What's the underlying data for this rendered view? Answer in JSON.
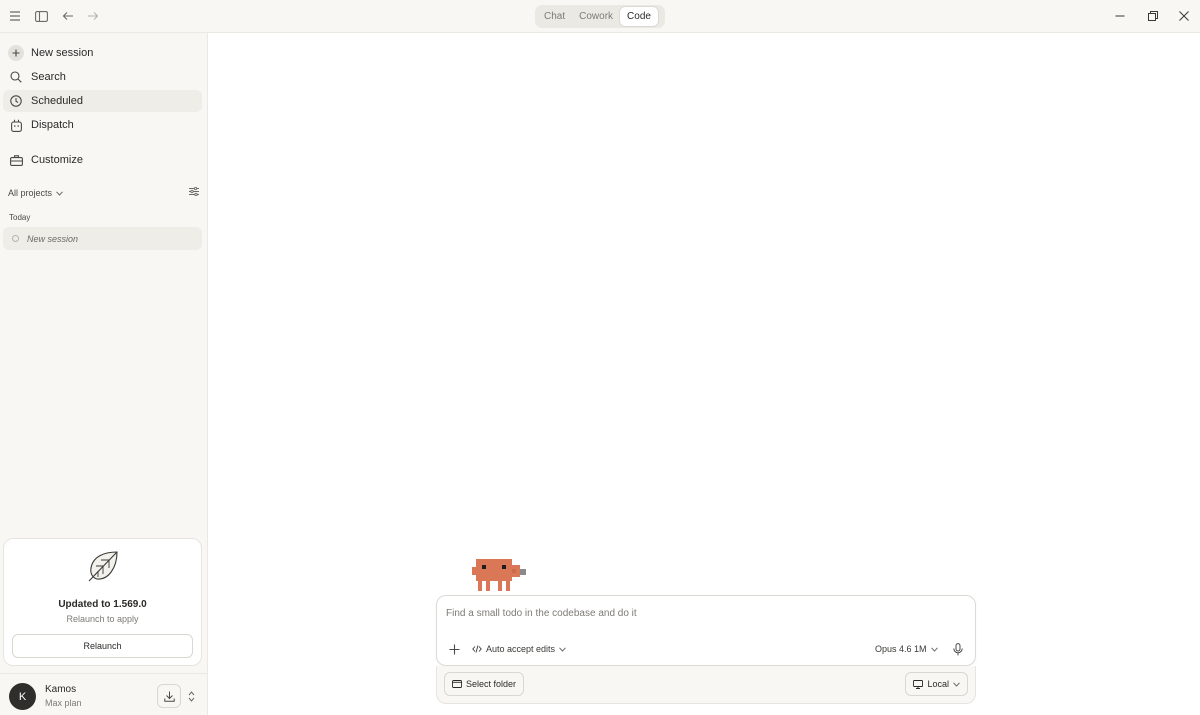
{
  "titlebar": {
    "modes": [
      {
        "label": "Chat",
        "active": false
      },
      {
        "label": "Cowork",
        "active": false
      },
      {
        "label": "Code",
        "active": true
      }
    ]
  },
  "sidebar": {
    "nav": {
      "new_session": "New session",
      "search": "Search",
      "scheduled": "Scheduled",
      "dispatch": "Dispatch",
      "customize": "Customize"
    },
    "projects_filter": "All projects",
    "group_label": "Today",
    "sessions": [
      {
        "title": "New session"
      }
    ],
    "update_card": {
      "title": "Updated to 1.569.0",
      "subtitle": "Relaunch to apply",
      "button": "Relaunch"
    },
    "user": {
      "initial": "K",
      "name": "Kamos",
      "plan": "Max plan"
    }
  },
  "composer": {
    "placeholder": "Find a small todo in the codebase and do it",
    "value": "",
    "permission_mode": "Auto accept edits",
    "model": "Opus 4.6 1M",
    "folder_button": "Select folder",
    "environment": "Local"
  },
  "colors": {
    "sidebar_bg": "#f8f7f4",
    "active_item_bg": "#efede7",
    "mascot": "#d97757"
  },
  "icons": [
    "menu-icon",
    "sidebar-toggle-icon",
    "back-arrow-icon",
    "forward-arrow-icon",
    "minimize-icon",
    "restore-icon",
    "close-icon",
    "plus-icon",
    "search-icon",
    "clock-icon",
    "dispatch-icon",
    "briefcase-icon",
    "filter-icon",
    "leaf-icon",
    "download-icon",
    "up-down-chevron-icon",
    "code-icon",
    "chevron-down-icon",
    "mic-icon",
    "folder-icon",
    "monitor-icon"
  ]
}
